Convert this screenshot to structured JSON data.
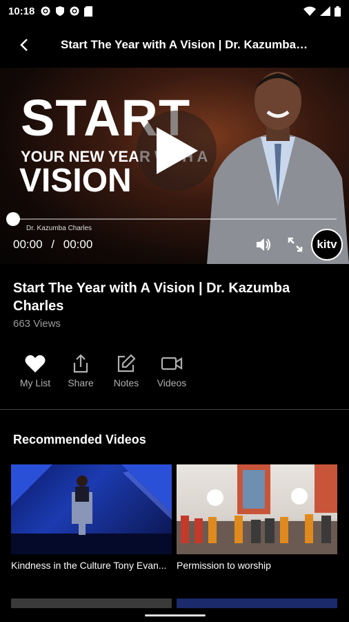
{
  "status": {
    "time": "10:18"
  },
  "header": {
    "title": "Start The Year with A Vision | Dr. Kazumba Ch..."
  },
  "player": {
    "line1": "START",
    "line2": "YOUR NEW YEAR WITH A",
    "line3": "VISION",
    "credit": "Dr. Kazumba Charles",
    "current_time": "00:00",
    "separator": "/",
    "duration": "00:00",
    "progress": 0,
    "logo_text": "kitv"
  },
  "video": {
    "title": "Start The Year with A Vision | Dr. Kazumba Charles",
    "views": "663 Views"
  },
  "actions": [
    {
      "label": "My List"
    },
    {
      "label": "Share"
    },
    {
      "label": "Notes"
    },
    {
      "label": "Videos"
    }
  ],
  "recommended": {
    "heading": "Recommended Videos",
    "items": [
      {
        "caption": "Kindness in the Culture  Tony Evan..."
      },
      {
        "caption": "Permission to worship"
      }
    ]
  }
}
